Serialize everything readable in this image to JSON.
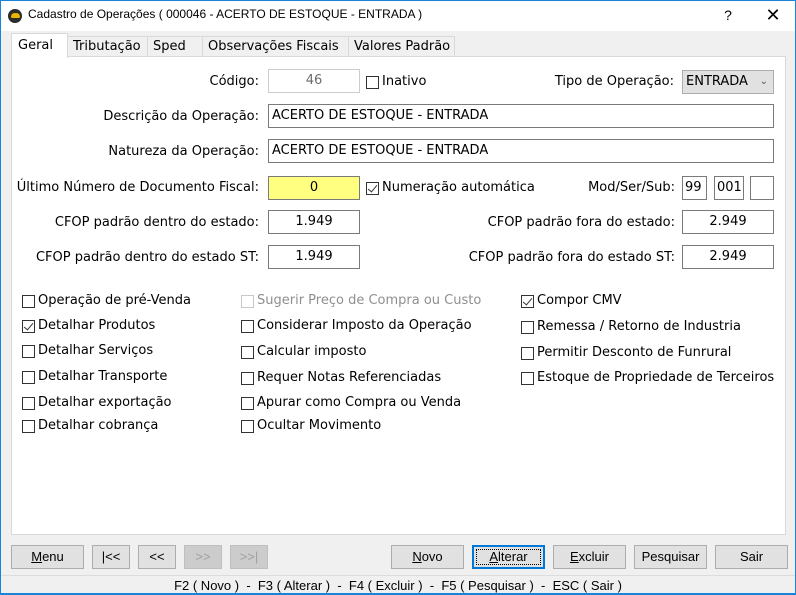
{
  "window": {
    "title": "Cadastro de Operações ( 000046 - ACERTO DE ESTOQUE - ENTRADA )",
    "help_label": "?",
    "close_label": "✕"
  },
  "tabs": [
    {
      "label": "Geral",
      "active": true
    },
    {
      "label": "Tributação",
      "active": false
    },
    {
      "label": "Sped",
      "active": false
    },
    {
      "label": "Observações Fiscais",
      "active": false
    },
    {
      "label": "Valores Padrão",
      "active": false
    }
  ],
  "form": {
    "codigo": {
      "label": "Código:",
      "value": "46"
    },
    "inativo": {
      "label": "Inativo",
      "checked": false
    },
    "tipo_operacao": {
      "label": "Tipo de Operação:",
      "value": "ENTRADA"
    },
    "descricao": {
      "label": "Descrição da Operação:",
      "value": "ACERTO DE ESTOQUE - ENTRADA"
    },
    "natureza": {
      "label": "Natureza da Operação:",
      "value": "ACERTO DE ESTOQUE - ENTRADA"
    },
    "ultimo_numero": {
      "label": "Último Número de Documento Fiscal:",
      "value": "0"
    },
    "numeracao_automatica": {
      "label": "Numeração automática",
      "checked": true
    },
    "mod_ser_sub": {
      "label": "Mod/Ser/Sub:",
      "mod": "99",
      "ser": "001",
      "sub": ""
    },
    "cfop_dentro": {
      "label": "CFOP padrão dentro do estado:",
      "value": "1.949"
    },
    "cfop_fora": {
      "label": "CFOP padrão fora do estado:",
      "value": "2.949"
    },
    "cfop_dentro_st": {
      "label": "CFOP padrão dentro do estado ST:",
      "value": "1.949"
    },
    "cfop_fora_st": {
      "label": "CFOP padrão fora do estado ST:",
      "value": "2.949"
    }
  },
  "checkboxes": {
    "col1": [
      {
        "label": "Operação de pré-Venda",
        "checked": false
      },
      {
        "label": "Detalhar Produtos",
        "checked": true
      },
      {
        "label": "Detalhar Serviços",
        "checked": false
      },
      {
        "label": "Detalhar Transporte",
        "checked": false
      },
      {
        "label": "Detalhar exportação",
        "checked": false
      },
      {
        "label": "Detalhar cobrança",
        "checked": false
      }
    ],
    "col2": [
      {
        "label": "Sugerir Preço de Compra ou Custo",
        "checked": false,
        "disabled": true
      },
      {
        "label": "Considerar Imposto da Operação",
        "checked": false
      },
      {
        "label": "Calcular imposto",
        "checked": false
      },
      {
        "label": "Requer Notas Referenciadas",
        "checked": false
      },
      {
        "label": "Apurar como Compra ou Venda",
        "checked": false
      },
      {
        "label": "Ocultar Movimento",
        "checked": false
      }
    ],
    "col3": [
      {
        "label": "Compor CMV",
        "checked": true
      },
      {
        "label": "Remessa / Retorno de Industria",
        "checked": false
      },
      {
        "label": "Permitir Desconto de Funrural",
        "checked": false
      },
      {
        "label": "Estoque de Propriedade de Terceiros",
        "checked": false
      }
    ]
  },
  "buttons": {
    "menu": {
      "hotkey": "M",
      "rest": "enu"
    },
    "first": "|<<",
    "prev": "<<",
    "next": ">>",
    "last": ">>|",
    "novo": {
      "hotkey": "N",
      "rest": "ovo"
    },
    "alterar": {
      "hotkey": "A",
      "rest": "lterar"
    },
    "excluir": {
      "hotkey": "E",
      "rest": "xcluir"
    },
    "pesquisar": "Pesquisar",
    "sair": "Sair"
  },
  "statusbar": {
    "text": "F2 ( Novo )  -  F3 ( Alterar )  -  F4 ( Excluir )  -  F5 ( Pesquisar )  -  ESC ( Sair )"
  }
}
